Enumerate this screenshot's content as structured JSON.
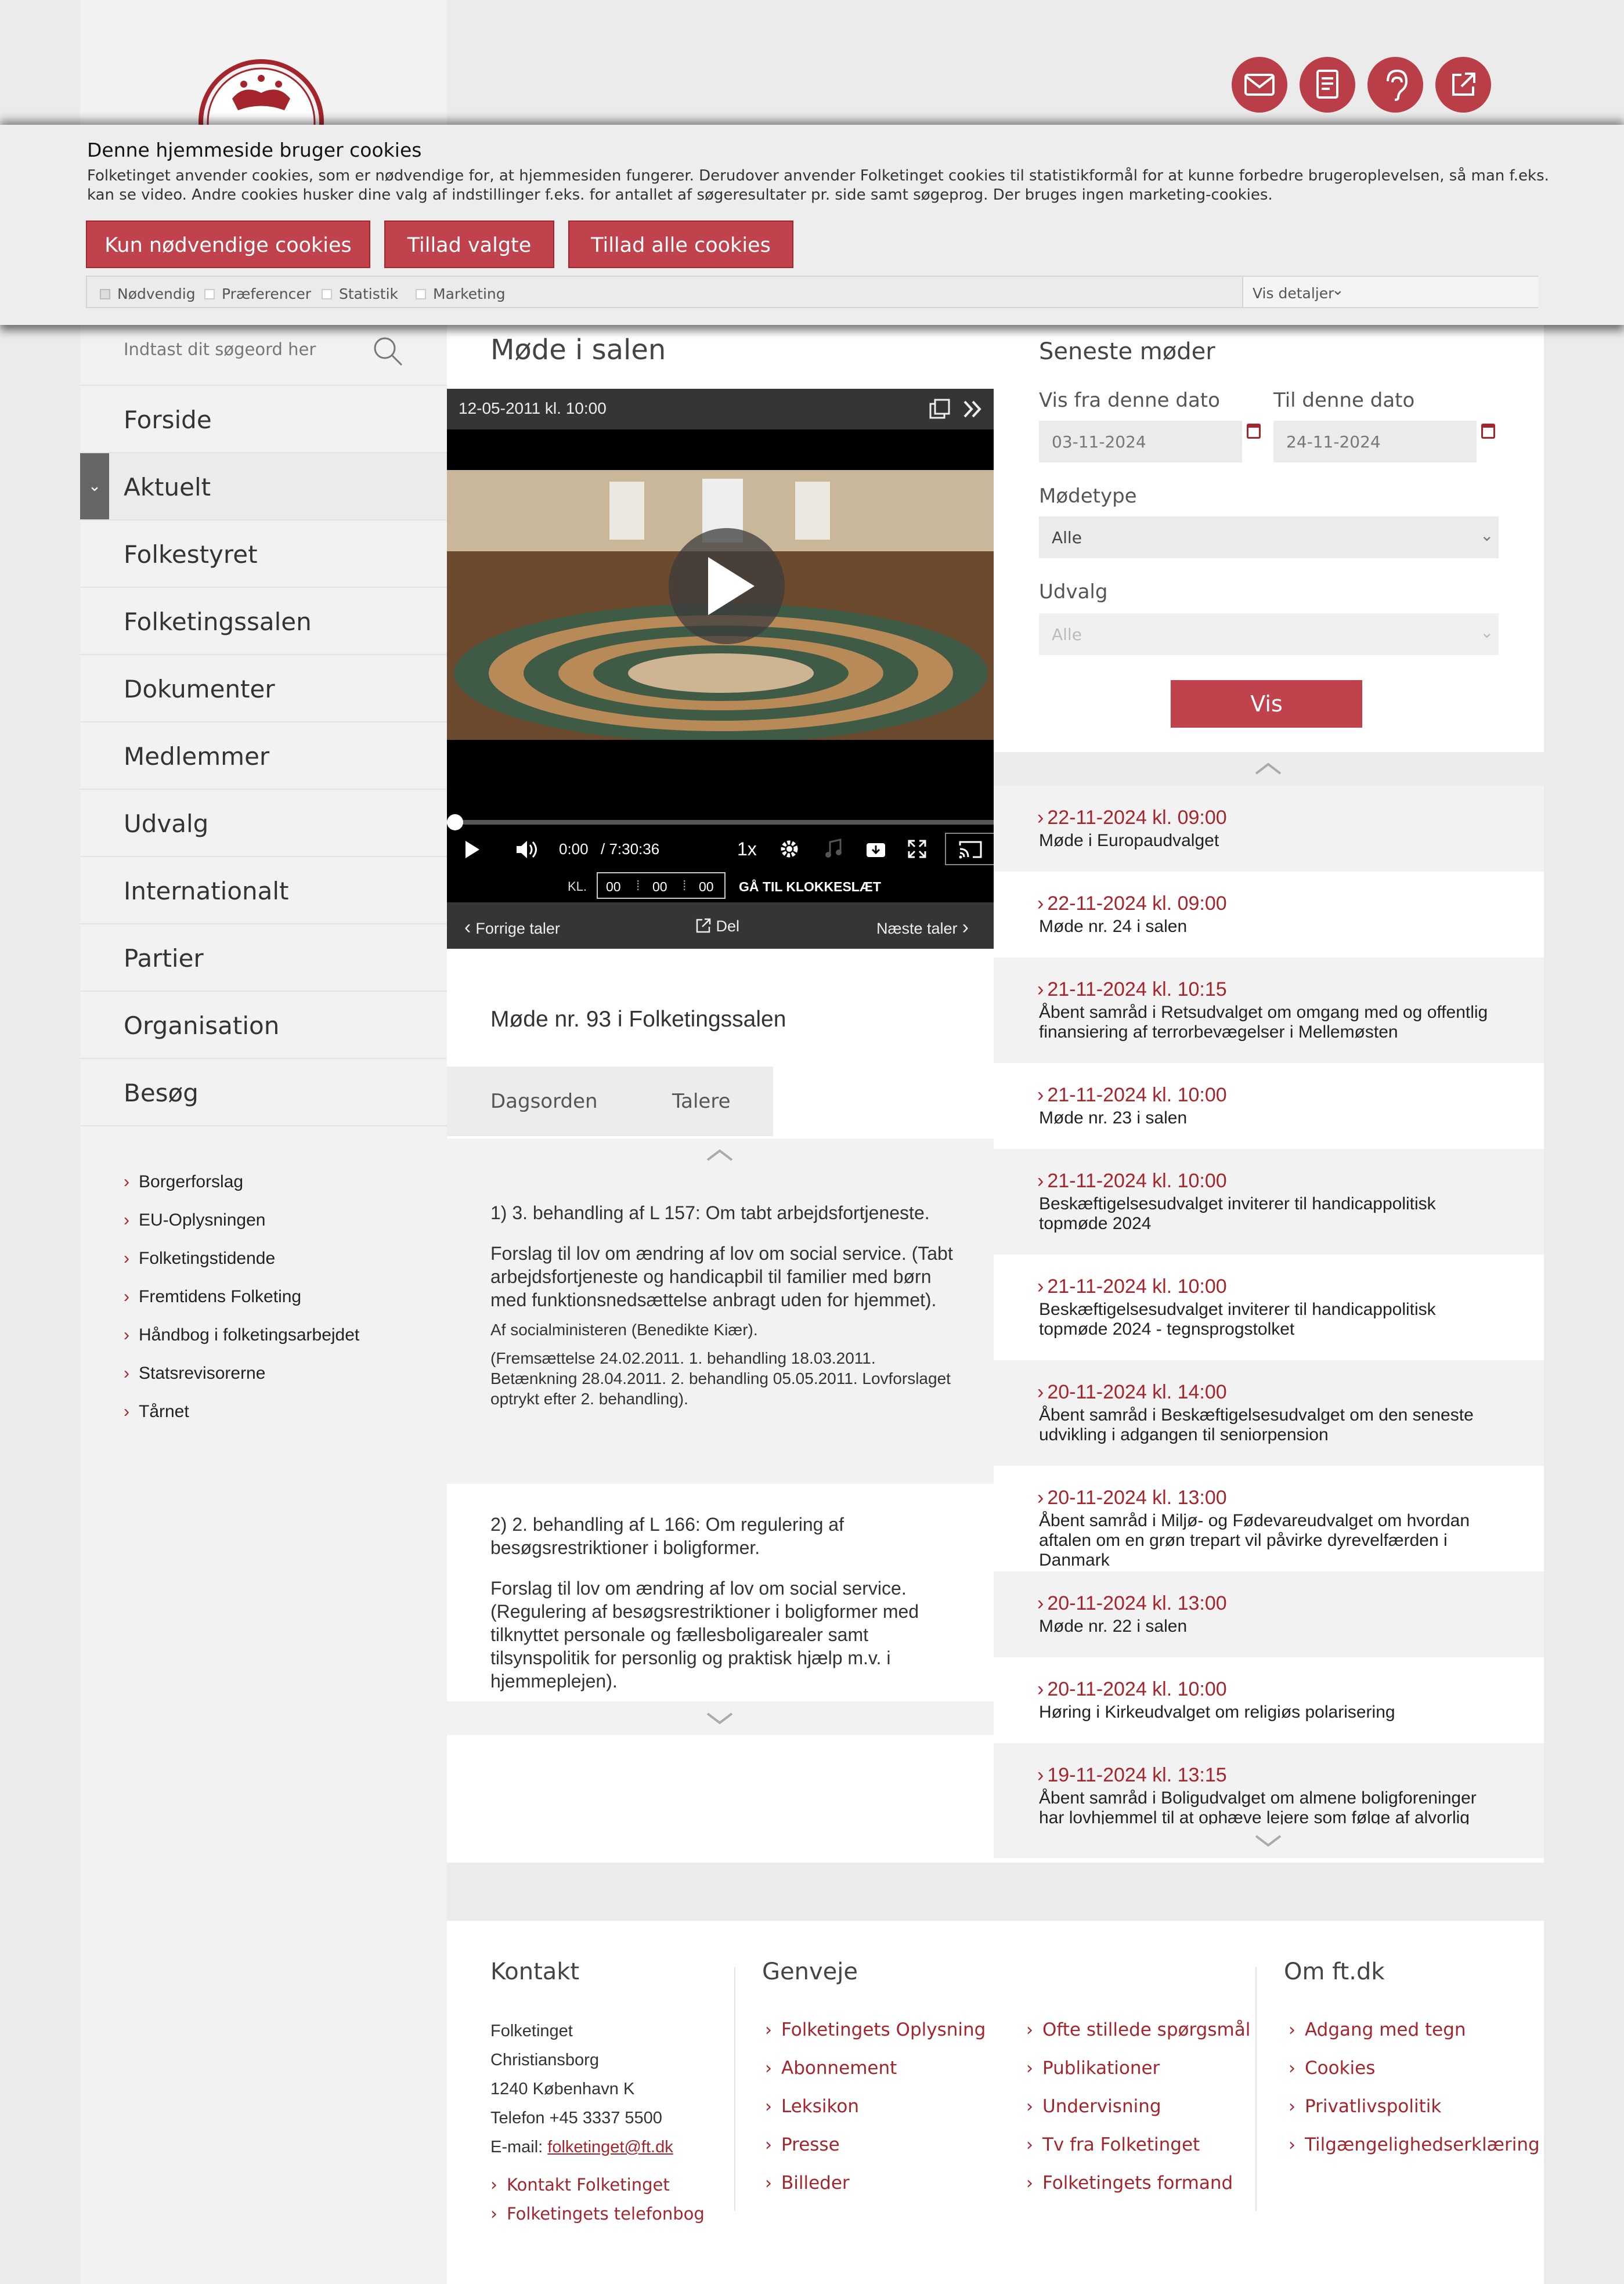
{
  "cookie_banner": {
    "title": "Denne hjemmeside bruger cookies",
    "text": "Folketinget anvender cookies, som er nødvendige for, at hjemmesiden fungerer.    Derudover anvender Folketinget cookies til statistikformål for at kunne forbedre brugeroplevelsen, så man f.eks. kan se video. Andre cookies husker dine valg af indstillinger f.eks. for antallet af søgeresultater pr. side samt søgeprog. Der bruges ingen marketing-cookies.",
    "btn_necessary": "Kun nødvendige cookies",
    "btn_selected": "Tillad valgte",
    "btn_all": "Tillad alle cookies",
    "checks": [
      "Nødvendig",
      "Præferencer",
      "Statistik",
      "Marketing"
    ],
    "details": "Vis detaljer"
  },
  "search": {
    "placeholder": "Indtast dit søgeord her"
  },
  "nav": [
    "Forside",
    "Aktuelt",
    "Folkestyret",
    "Folketingssalen",
    "Dokumenter",
    "Medlemmer",
    "Udvalg",
    "Internationalt",
    "Partier",
    "Organisation",
    "Besøg"
  ],
  "sub_links": [
    "Borgerforslag",
    "EU-Oplysningen",
    "Folketingstidende",
    "Fremtidens Folketing",
    "Håndbog i folketingsarbejdet",
    "Statsrevisorerne",
    "Tårnet"
  ],
  "main": {
    "title": "Møde i salen",
    "video_date": "12-05-2011 kl. 10:00",
    "time_current": "0:00",
    "time_total": "/ 7:30:36",
    "speed": "1x",
    "kl_label": "KL.",
    "clock": [
      "00",
      "00",
      "00"
    ],
    "goto": "GÅ TIL KLOKKESLÆT",
    "prev": "Forrige taler",
    "share": "Del",
    "next": "Næste taler",
    "meeting_title": "Møde nr. 93 i Folketingssalen",
    "tabs": [
      "Dagsorden",
      "Talere"
    ],
    "agenda": [
      {
        "heading": "1) 3. behandling af L 157: Om tabt arbejdsfortjeneste.",
        "desc": "Forslag til lov om ændring af lov om social service. (Tabt arbejdsfortjeneste og handicapbil til familier med børn med funktionsnedsættelse anbragt uden for hjemmet).",
        "by": "Af socialministeren (Benedikte Kiær).",
        "history": "(Fremsættelse 24.02.2011. 1. behandling 18.03.2011. Betænkning 28.04.2011. 2. behandling 05.05.2011. Lovforslaget optrykt efter 2. behandling)."
      },
      {
        "heading": "2) 2. behandling af L 166: Om regulering af besøgsrestriktioner i boligformer.",
        "desc": "Forslag til lov om ændring af lov om social service. (Regulering af besøgsrestriktioner i boligformer med tilknyttet personale og fællesboligarealer samt tilsynspolitik for personlig og praktisk hjælp m.v. i hjemmeplejen)."
      }
    ]
  },
  "sidebar": {
    "title": "Seneste møder",
    "from_label": "Vis fra denne dato",
    "to_label": "Til denne dato",
    "from_value": "03-11-2024",
    "to_value": "24-11-2024",
    "type_label": "Mødetype",
    "type_value": "Alle",
    "committee_label": "Udvalg",
    "committee_value": "Alle",
    "show_btn": "Vis",
    "meetings": [
      {
        "date": "22-11-2024 kl. 09:00",
        "text": "Møde i Europaudvalget"
      },
      {
        "date": "22-11-2024 kl. 09:00",
        "text": "Møde nr. 24 i salen"
      },
      {
        "date": "21-11-2024 kl. 10:15",
        "text": "Åbent samråd i Retsudvalget om omgang med og offentlig finansiering af terrorbevægelser i Mellemøsten"
      },
      {
        "date": "21-11-2024 kl. 10:00",
        "text": "Møde nr. 23 i salen"
      },
      {
        "date": "21-11-2024 kl. 10:00",
        "text": "Beskæftigelsesudvalget inviterer til handicappolitisk topmøde 2024"
      },
      {
        "date": "21-11-2024 kl. 10:00",
        "text": "Beskæftigelsesudvalget inviterer til handicappolitisk topmøde 2024 - tegnsprogstolket"
      },
      {
        "date": "20-11-2024 kl. 14:00",
        "text": "Åbent samråd i Beskæftigelsesudvalget om den seneste udvikling i adgangen til seniorpension"
      },
      {
        "date": "20-11-2024 kl. 13:00",
        "text": "Åbent samråd i Miljø- og Fødevareudvalget om hvordan aftalen om en grøn trepart vil påvirke dyrevelfærden i Danmark"
      },
      {
        "date": "20-11-2024 kl. 13:00",
        "text": "Møde nr. 22 i salen"
      },
      {
        "date": "20-11-2024 kl. 10:00",
        "text": "Høring i Kirkeudvalget om religiøs polarisering"
      },
      {
        "date": "19-11-2024 kl. 13:15",
        "text": "Åbent samråd i Boligudvalget om almene boligforeninger har lovhjemmel til at ophæve lejere som følge af alvorlig kriminalitet"
      }
    ]
  },
  "footer": {
    "contact_title": "Kontakt",
    "contact_lines": [
      "Folketinget",
      "Christiansborg",
      "1240 København K",
      "Telefon +45 3337 5500"
    ],
    "email_label": "E-mail:",
    "email": "folketinget@ft.dk",
    "contact_links": [
      "Kontakt Folketinget",
      "Folketingets telefonbog"
    ],
    "shortcuts_title": "Genveje",
    "shortcuts_a": [
      "Folketingets Oplysning",
      "Abonnement",
      "Leksikon",
      "Presse",
      "Billeder"
    ],
    "shortcuts_b": [
      "Ofte stillede spørgsmål",
      "Publikationer",
      "Undervisning",
      "Tv fra Folketinget",
      "Folketingets formand"
    ],
    "about_title": "Om ft.dk",
    "about_links": [
      "Adgang med tegn",
      "Cookies",
      "Privatlivspolitik",
      "Tilgængelighedserklæring"
    ]
  },
  "header_icons": [
    "mail-icon",
    "document-icon",
    "hearing-icon",
    "external-link-icon"
  ],
  "colors": {
    "accent": "#a4262c",
    "button": "#c0424c"
  }
}
